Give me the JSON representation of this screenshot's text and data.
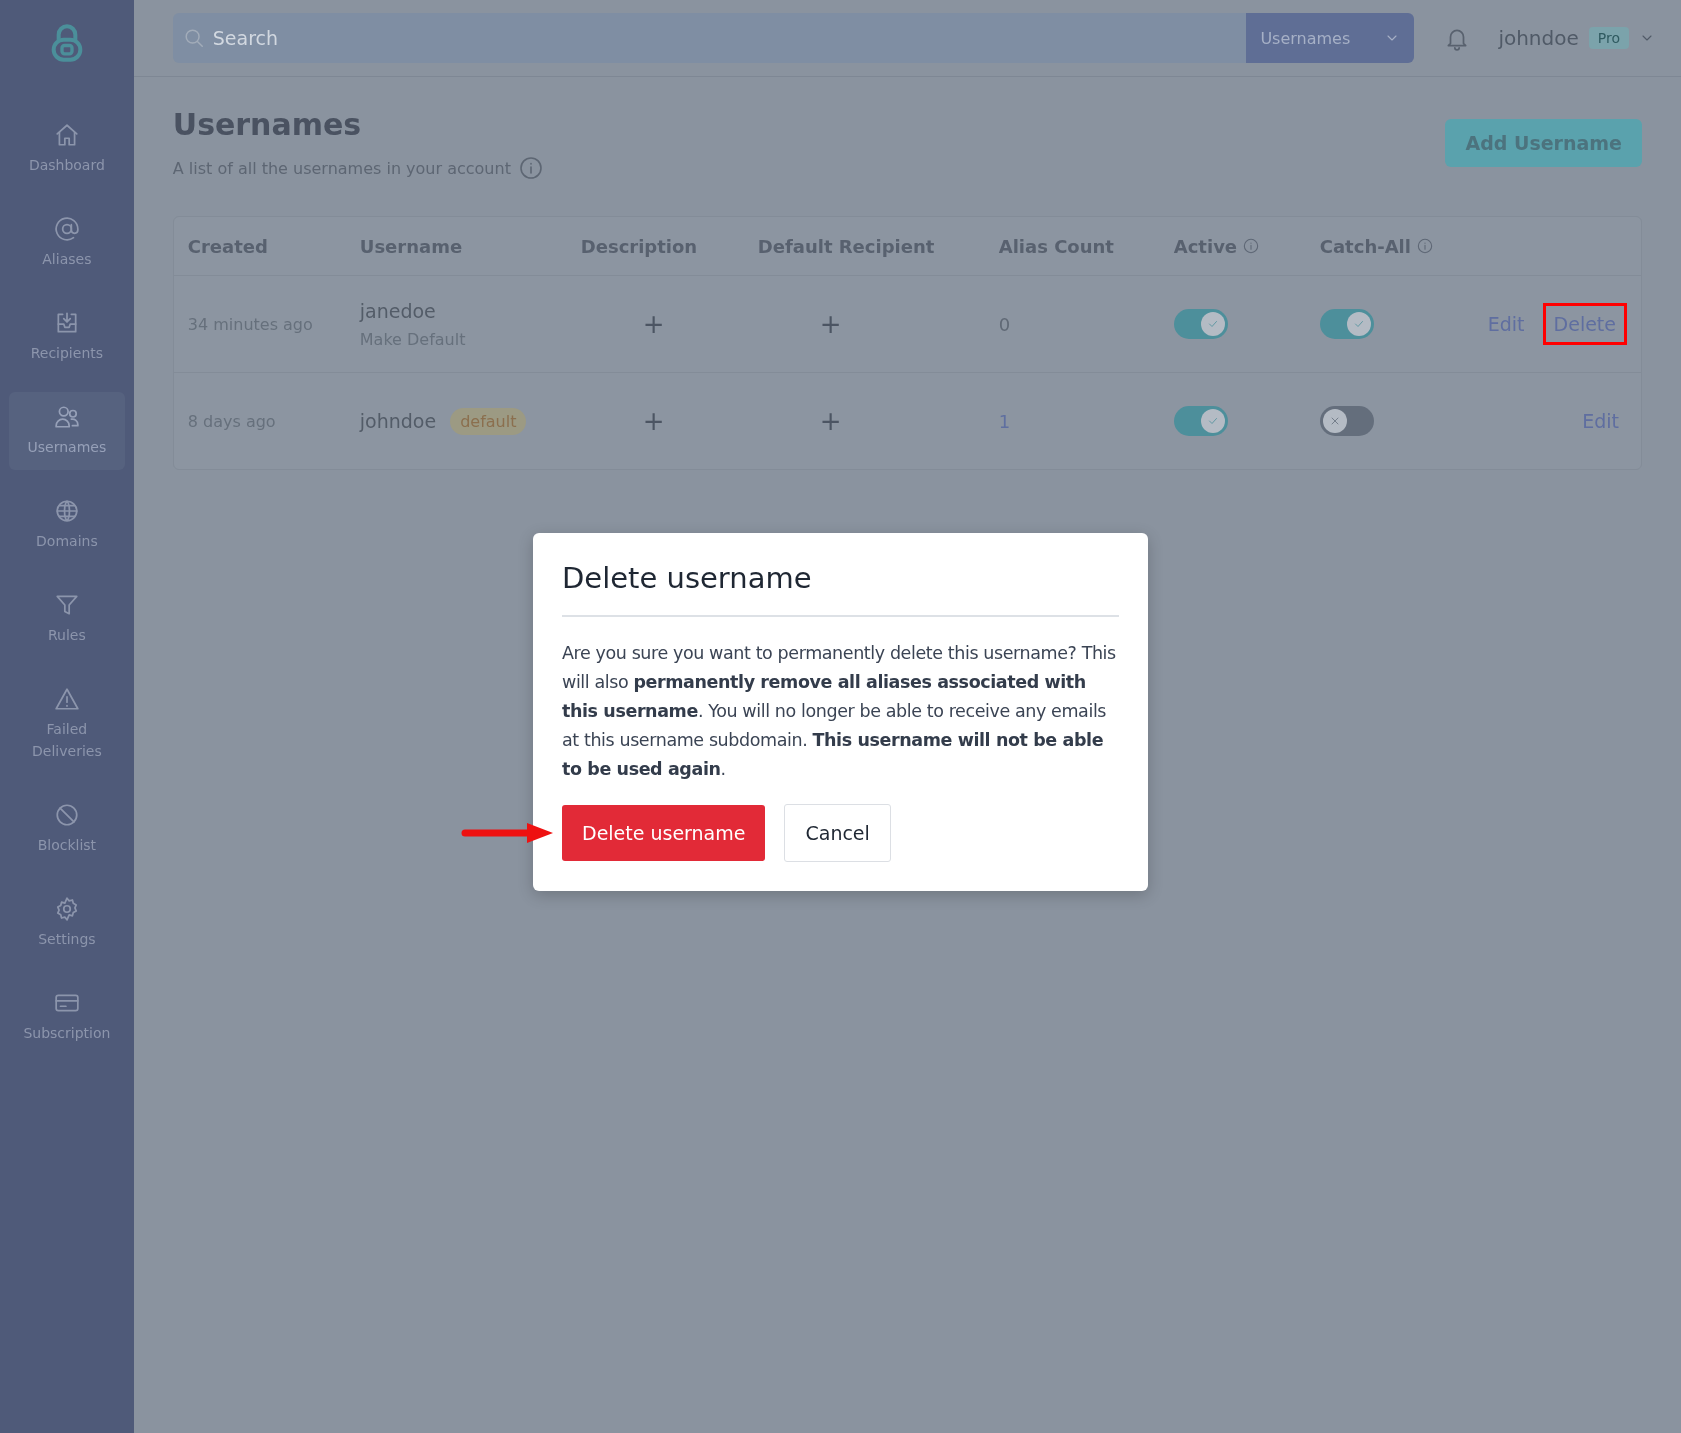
{
  "sidebar": {
    "items": [
      {
        "label": "Dashboard",
        "selected": false
      },
      {
        "label": "Aliases",
        "selected": false
      },
      {
        "label": "Recipients",
        "selected": false
      },
      {
        "label": "Usernames",
        "selected": true
      },
      {
        "label": "Domains",
        "selected": false
      },
      {
        "label": "Rules",
        "selected": false
      },
      {
        "label": "Failed Deliveries",
        "selected": false
      },
      {
        "label": "Blocklist",
        "selected": false
      },
      {
        "label": "Settings",
        "selected": false
      },
      {
        "label": "Subscription",
        "selected": false
      }
    ]
  },
  "topbar": {
    "search": {
      "placeholder": "Search"
    },
    "scope": "Usernames",
    "user": "johndoe",
    "plan": "Pro"
  },
  "page": {
    "title": "Usernames",
    "subtitle": "A list of all the usernames in your account",
    "add_button": "Add Username"
  },
  "table": {
    "columns": [
      {
        "label": "Created",
        "info": false
      },
      {
        "label": "Username",
        "info": false
      },
      {
        "label": "Description",
        "info": false
      },
      {
        "label": "Default Recipient",
        "info": false
      },
      {
        "label": "Alias Count",
        "info": false
      },
      {
        "label": "Active",
        "info": true
      },
      {
        "label": "Catch-All",
        "info": true
      }
    ],
    "rows": [
      {
        "created": "34 minutes ago",
        "username": "janedoe",
        "make_default": "Make Default",
        "description": "+",
        "default_recipient": "+",
        "alias_count": "0",
        "active": true,
        "catch_all": true,
        "actions": [
          {
            "label": "Edit",
            "highlighted": false
          },
          {
            "label": "Delete",
            "highlighted": true
          }
        ]
      },
      {
        "created": "8 days ago",
        "username": "johndoe",
        "badge": "default",
        "description": "+",
        "default_recipient": "+",
        "alias_count": "1",
        "active": true,
        "catch_all": false,
        "actions": [
          {
            "label": "Edit",
            "highlighted": false
          }
        ]
      }
    ]
  },
  "dialog": {
    "title": "Delete username",
    "body": "Are you sure you want to permanently delete this username? This will also **permanently remove all aliases associated with this username**. You will no longer be able to receive any emails at this username subdomain. **This username will not be able to be used again**.",
    "confirm": {
      "label": "Delete username",
      "pointed": true
    },
    "cancel": "Cancel"
  }
}
